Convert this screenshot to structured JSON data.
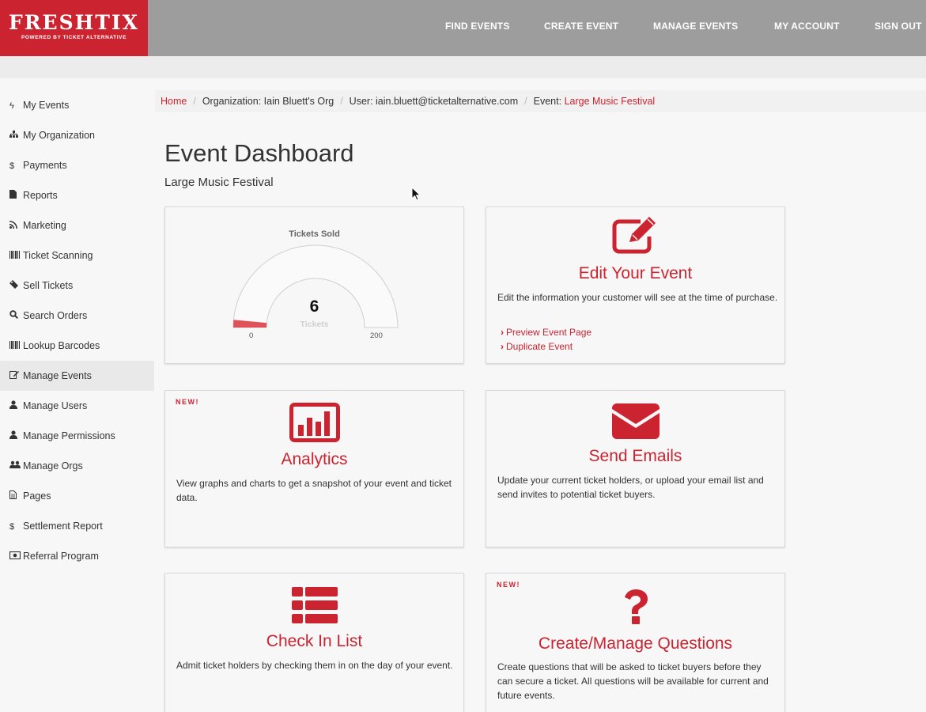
{
  "brand": {
    "name": "FRESHTIX",
    "tagline": "POWERED BY TICKET ALTERNATIVE",
    "accent_color": "#cc2330"
  },
  "nav": [
    "FIND EVENTS",
    "CREATE EVENT",
    "MANAGE EVENTS",
    "MY ACCOUNT",
    "SIGN OUT"
  ],
  "sidebar": {
    "active": "Manage Events",
    "items": [
      {
        "label": "My Events",
        "icon": "bolt-icon"
      },
      {
        "label": "My Organization",
        "icon": "sitemap-icon"
      },
      {
        "label": "Payments",
        "icon": "dollar-icon"
      },
      {
        "label": "Reports",
        "icon": "file-icon"
      },
      {
        "label": "Marketing",
        "icon": "rss-icon"
      },
      {
        "label": "Ticket Scanning",
        "icon": "barcode-icon"
      },
      {
        "label": "Sell Tickets",
        "icon": "ticket-icon"
      },
      {
        "label": "Search Orders",
        "icon": "search-icon"
      },
      {
        "label": "Lookup Barcodes",
        "icon": "barcode-icon"
      },
      {
        "label": "Manage Events",
        "icon": "edit-icon"
      },
      {
        "label": "Manage Users",
        "icon": "user-icon"
      },
      {
        "label": "Manage Permissions",
        "icon": "user-icon"
      },
      {
        "label": "Manage Orgs",
        "icon": "users-icon"
      },
      {
        "label": "Pages",
        "icon": "file-text-icon"
      },
      {
        "label": "Settlement Report",
        "icon": "dollar-icon"
      },
      {
        "label": "Referral Program",
        "icon": "money-icon"
      }
    ]
  },
  "breadcrumb": {
    "home": "Home",
    "organization": "Organization: Iain Bluett's Org",
    "user": "User: iain.bluett@ticketalternative.com",
    "event_prefix": "Event: ",
    "event_name": "Large Music Festival"
  },
  "page": {
    "title": "Event Dashboard",
    "subtitle": "Large Music Festival"
  },
  "gauge": {
    "title": "Tickets Sold",
    "value": 6,
    "unit": "Tickets",
    "min": 0,
    "max": 200
  },
  "cards": {
    "edit": {
      "title": "Edit Your Event",
      "description": "Edit the information your customer will see at the time of purchase.",
      "links": [
        "Preview Event Page",
        "Duplicate Event"
      ],
      "icon": "edit-square-icon"
    },
    "analytics": {
      "badge": "NEW!",
      "title": "Analytics",
      "description": "View graphs and charts to get a snapshot of your event and ticket data.",
      "icon": "bar-chart-icon"
    },
    "emails": {
      "title": "Send Emails",
      "description": "Update your current ticket holders, or upload your email list and send invites to potential ticket buyers.",
      "icon": "envelope-icon"
    },
    "checkin": {
      "title": "Check In List",
      "description": "Admit ticket holders by checking them in on the day of your event.",
      "icon": "list-icon"
    },
    "questions": {
      "badge": "NEW!",
      "title": "Create/Manage Questions",
      "description": "Create questions that will be asked to ticket buyers before they can secure a ticket. All questions will be available for current and future events.",
      "icon": "question-icon"
    }
  }
}
